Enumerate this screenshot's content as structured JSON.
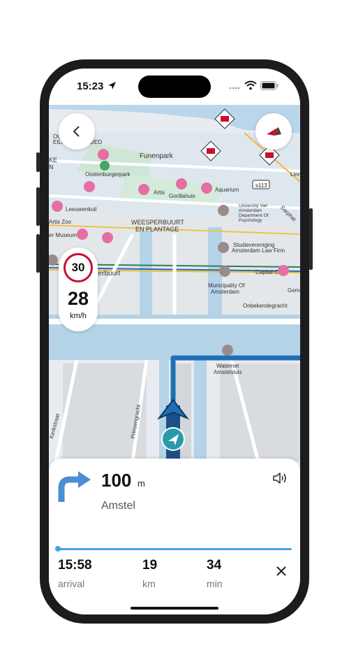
{
  "status": {
    "time": "15:23"
  },
  "map": {
    "labels": {
      "funenpark": "Funenpark",
      "oostenburgerpark": "Oostenburgerpark",
      "leeuwenkuil": "Leeuwenkuil",
      "artis": "Artis",
      "gorillahuis": "Gorillahuis",
      "aquarium": "Aquarium",
      "artis_zoo": "Artis Zoo",
      "museum": "er Museum",
      "weesperbuurt_1": "WEESPERBUURT",
      "weesperbuurt_2": "EN PLANTAGE",
      "uva_1": "University Van",
      "uva_2": "Amsterdam",
      "uva_3": "Department Of",
      "uva_4": "Psychology",
      "studie_1": "Studievereniging",
      "studie_2": "Amsterdam Law Firm",
      "sperbuurt": "sperbuurt",
      "capital": "Capital C",
      "gemeente": "Geme",
      "municipality_1": "Municipality Of",
      "municipality_2": "Amsterdam",
      "onbekende": "Onbekendegracht",
      "waternet_1": "Waternet",
      "waternet_2": "Amstelsluis",
      "kerkstraat": "Kerkstraat",
      "prinsengracht": "Prinsengracht",
      "linn": "Linn",
      "sarphati": "Sarphat",
      "s113": "s113",
      "oostelijk_1": "OOSTELIJK",
      "oostelijk_2": "EILANDENGEBIED",
      "ke": "KE",
      "n": "N"
    }
  },
  "speed": {
    "limit": "30",
    "current": "28",
    "unit": "km/h"
  },
  "instruction": {
    "distance": "100",
    "distance_unit": "m",
    "street": "Amstel"
  },
  "trip": {
    "arrival_value": "15:58",
    "arrival_label": "arrival",
    "distance_value": "19",
    "distance_label": "km",
    "duration_value": "34",
    "duration_label": "min",
    "progress": 0.01
  },
  "colors": {
    "route": "#1f6fb5",
    "progress": "#4aa3df",
    "speed_limit_ring": "#c8102e",
    "poi_pink": "#e36fa5",
    "water": "#b5d3e7"
  },
  "icons": [
    "back-arrow-icon",
    "compass-icon",
    "roadwork-icon",
    "navigation-arrow-icon",
    "speaker-icon",
    "close-icon",
    "turn-right-icon",
    "location-arrow-icon",
    "signal-icon",
    "wifi-icon",
    "battery-icon"
  ]
}
